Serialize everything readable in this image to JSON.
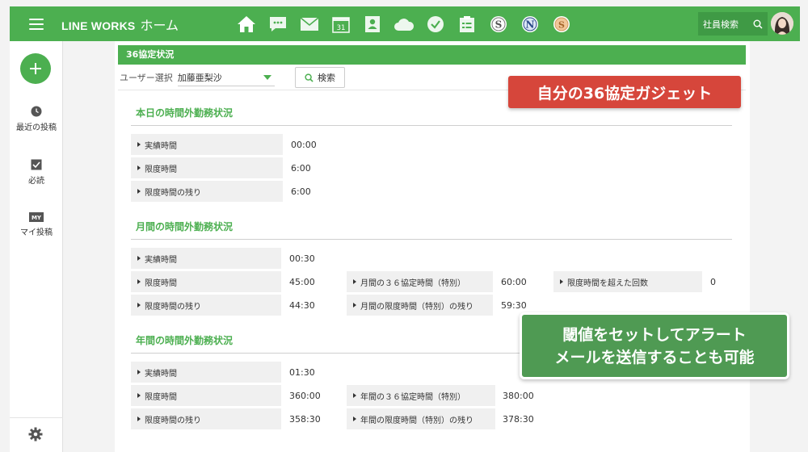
{
  "header": {
    "brand": "LINE WORKS",
    "subtitle": "ホーム",
    "search_label": "社員検索",
    "apps": [
      "home-icon",
      "chat-icon",
      "mail-icon",
      "calendar-icon",
      "contacts-icon",
      "cloud-drive-icon",
      "task-check-icon",
      "form-icon",
      "s-app-icon",
      "n-app-icon",
      "coin-app-icon"
    ],
    "calendar_day": "31"
  },
  "sidebar": {
    "items": [
      {
        "label": "最近の投稿",
        "icon": "clock-icon"
      },
      {
        "label": "必読",
        "icon": "checkbox-icon"
      },
      {
        "label": "マイ投稿",
        "icon": "my-icon"
      }
    ],
    "my_badge": "MY"
  },
  "widget": {
    "title": "36協定状況",
    "user_label": "ユーザー選択",
    "user_value": "加藤亜梨沙",
    "search_button": "検索"
  },
  "daily": {
    "title": "本日の時間外勤務状況",
    "rows": [
      {
        "label": "実績時間",
        "value": "00:00"
      },
      {
        "label": "限度時間",
        "value": "6:00"
      },
      {
        "label": "限度時間の残り",
        "value": "6:00"
      }
    ]
  },
  "monthly": {
    "title": "月間の時間外勤務状況",
    "col1": [
      {
        "label": "実績時間",
        "value": "00:30"
      },
      {
        "label": "限度時間",
        "value": "45:00"
      },
      {
        "label": "限度時間の残り",
        "value": "44:30"
      }
    ],
    "col2": [
      {
        "label": "月間の３６協定時間（特別）",
        "value": "60:00"
      },
      {
        "label": "月間の限度時間（特別）の残り",
        "value": "59:30"
      }
    ],
    "col3": [
      {
        "label": "限度時間を超えた回数",
        "value": "0"
      }
    ]
  },
  "yearly": {
    "title": "年間の時間外勤務状況",
    "col1": [
      {
        "label": "実績時間",
        "value": "01:30"
      },
      {
        "label": "限度時間",
        "value": "360:00"
      },
      {
        "label": "限度時間の残り",
        "value": "358:30"
      }
    ],
    "col2": [
      {
        "label": "年間の３６協定時間（特別）",
        "value": "380:00"
      },
      {
        "label": "年間の限度時間（特別）の残り",
        "value": "378:30"
      }
    ]
  },
  "callouts": {
    "red": "自分の36協定ガジェット",
    "green_line1": "閾値をセットしてアラート",
    "green_line2": "メールを送信することも可能"
  },
  "colors": {
    "brand_green": "#4caf50",
    "callout_red": "#d6463b",
    "callout_green": "#4f9a53"
  }
}
